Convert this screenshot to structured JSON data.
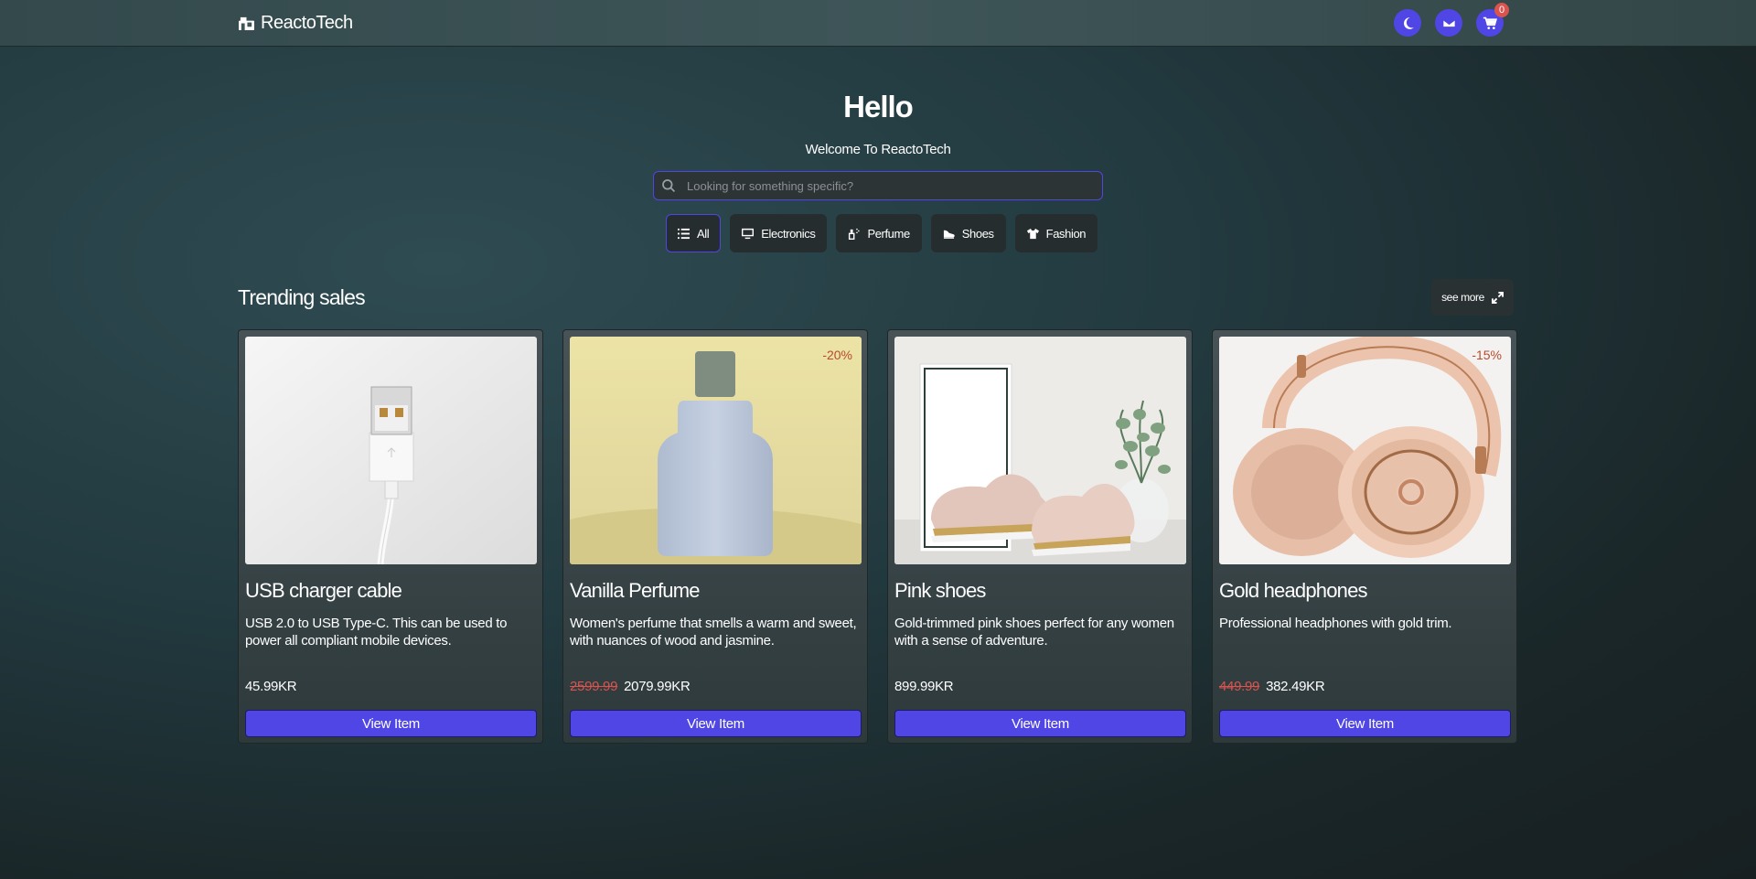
{
  "navbar": {
    "brand": "ReactoTech",
    "icons": [
      "moon-icon",
      "envelope-icon",
      "cart-icon"
    ],
    "cart_count": "0",
    "accent": "#4f46e5"
  },
  "hero": {
    "title": "Hello",
    "subtitle": "Welcome To ReactoTech"
  },
  "search": {
    "placeholder": "Looking for something specific?"
  },
  "categories": [
    {
      "label": "All",
      "icon": "list-icon",
      "active": true
    },
    {
      "label": "Electronics",
      "icon": "monitor-icon",
      "active": false
    },
    {
      "label": "Perfume",
      "icon": "spray-bottle-icon",
      "active": false
    },
    {
      "label": "Shoes",
      "icon": "shoe-icon",
      "active": false
    },
    {
      "label": "Fashion",
      "icon": "shirt-icon",
      "active": false
    }
  ],
  "trending": {
    "title": "Trending sales",
    "see_more": "see more"
  },
  "products": [
    {
      "title": "USB charger cable",
      "description": "USB 2.0 to USB Type-C. This can be used to power all compliant mobile devices.",
      "old_price": "",
      "price": "45.99KR",
      "discount": "",
      "button": "View Item",
      "image": "usb-cable-image"
    },
    {
      "title": "Vanilla Perfume",
      "description": "Women's perfume that smells a warm and sweet, with nuances of wood and jasmine.",
      "old_price": "2599.99",
      "price": "2079.99KR",
      "discount": "-20%",
      "button": "View Item",
      "image": "perfume-bottle-image"
    },
    {
      "title": "Pink shoes",
      "description": "Gold-trimmed pink shoes perfect for any women with a sense of adventure.",
      "old_price": "",
      "price": "899.99KR",
      "discount": "",
      "button": "View Item",
      "image": "pink-shoes-image"
    },
    {
      "title": "Gold headphones",
      "description": "Professional headphones with gold trim.",
      "old_price": "449.99",
      "price": "382.49KR",
      "discount": "-15%",
      "button": "View Item",
      "image": "headphones-image"
    }
  ]
}
